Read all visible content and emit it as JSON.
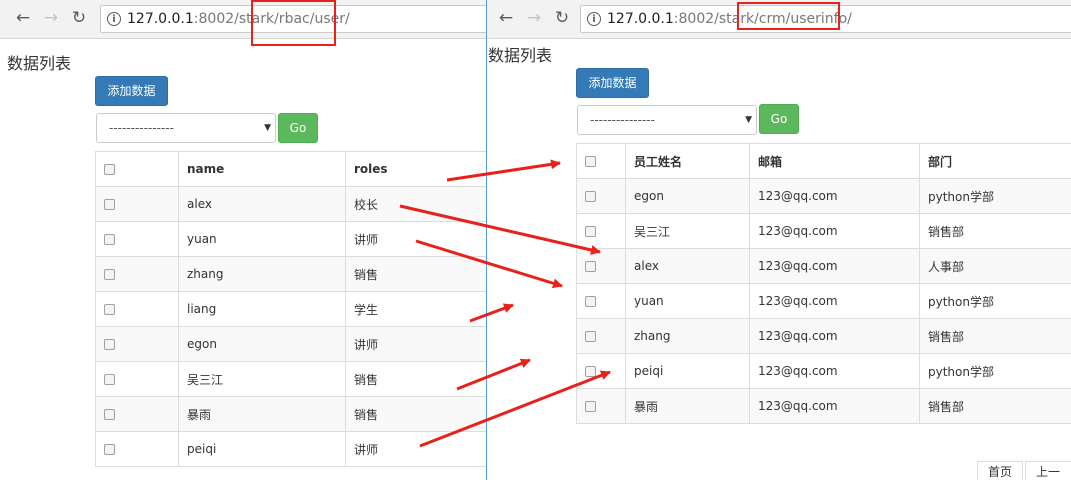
{
  "left": {
    "url_host": "127.0.0.1",
    "url_rest": ":8002/stark",
    "url_boxed": "/rbac/user/",
    "page_title": "数据列表",
    "add_button": "添加数据",
    "select_value": "---------------",
    "go_button": "Go",
    "columns": [
      "name",
      "roles"
    ],
    "rows": [
      {
        "name": "alex",
        "role": "校长"
      },
      {
        "name": "yuan",
        "role": "讲师"
      },
      {
        "name": "zhang",
        "role": "销售"
      },
      {
        "name": "liang",
        "role": "学生"
      },
      {
        "name": "egon",
        "role": "讲师"
      },
      {
        "name": "吴三江",
        "role": "销售"
      },
      {
        "name": "暴雨",
        "role": "销售"
      },
      {
        "name": "peiqi",
        "role": "讲师"
      }
    ]
  },
  "right": {
    "url_host": "127.0.0.1",
    "url_rest": ":8002/stark",
    "url_boxed": "/crm/userinfo/",
    "page_title": "数据列表",
    "add_button": "添加数据",
    "select_value": "---------------",
    "go_button": "Go",
    "columns": [
      "员工姓名",
      "邮箱",
      "部门"
    ],
    "rows": [
      {
        "name": "egon",
        "email": "123@qq.com",
        "dept": "python学部"
      },
      {
        "name": "吴三江",
        "email": "123@qq.com",
        "dept": "销售部"
      },
      {
        "name": "alex",
        "email": "123@qq.com",
        "dept": "人事部"
      },
      {
        "name": "yuan",
        "email": "123@qq.com",
        "dept": "python学部"
      },
      {
        "name": "zhang",
        "email": "123@qq.com",
        "dept": "销售部"
      },
      {
        "name": "peiqi",
        "email": "123@qq.com",
        "dept": "python学部"
      },
      {
        "name": "暴雨",
        "email": "123@qq.com",
        "dept": "销售部"
      }
    ],
    "pager": {
      "first": "首页",
      "prev": "上一页"
    }
  },
  "colors": {
    "annotation": "#e8221b",
    "primary": "#337ab7",
    "success": "#5cb85c"
  },
  "icons": [
    "back-arrow-icon",
    "forward-arrow-icon",
    "reload-icon",
    "info-icon",
    "checkbox-icon",
    "dropdown-caret-icon"
  ]
}
